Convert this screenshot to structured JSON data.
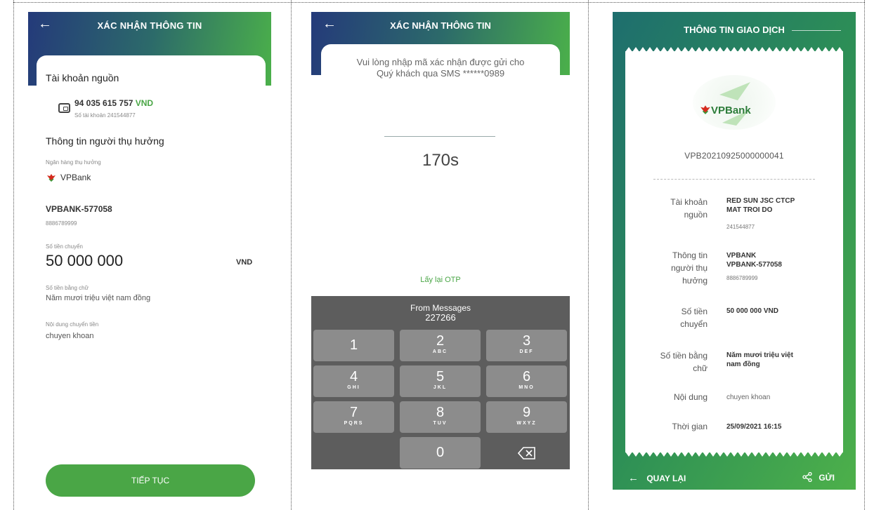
{
  "screen1": {
    "header_title": "XÁC NHẬN THÔNG TIN",
    "source_section": "Tài khoản nguồn",
    "balance_amount": "94 035 615 757",
    "balance_currency": "VND",
    "account_number_line": "Số tài khoản 241544877",
    "beneficiary_section": "Thông tin người thụ hưởng",
    "bank_label": "Ngân hàng thụ hưởng",
    "bank_name": "VPBank",
    "beneficiary_name": "VPBANK-577058",
    "beneficiary_account": "8886789999",
    "amount_label": "Số tiền chuyển",
    "amount_value": "50 000 000",
    "amount_currency": "VND",
    "amount_words_label": "Số tiền bằng chữ",
    "amount_words": "Năm mươi triệu việt nam đồng",
    "content_label": "Nội dung chuyển tiền",
    "content_value": "chuyen khoan",
    "continue_button": "TIẾP TỤC"
  },
  "screen2": {
    "header_title": "XÁC NHẬN THÔNG TIN",
    "message_line1": "Vui lòng nhập mã xác nhận được gửi cho",
    "message_line2": "Quý khách qua SMS ******0989",
    "timer": "170s",
    "resend_otp": "Lấy lại OTP",
    "keyboard": {
      "suggestion_source": "From Messages",
      "suggestion_code": "227266",
      "keys": [
        {
          "n": "1",
          "l": ""
        },
        {
          "n": "2",
          "l": "ABC"
        },
        {
          "n": "3",
          "l": "DEF"
        },
        {
          "n": "4",
          "l": "GHI"
        },
        {
          "n": "5",
          "l": "JKL"
        },
        {
          "n": "6",
          "l": "MNO"
        },
        {
          "n": "7",
          "l": "PQRS"
        },
        {
          "n": "8",
          "l": "TUV"
        },
        {
          "n": "9",
          "l": "WXYZ"
        },
        {
          "n": "0",
          "l": ""
        }
      ]
    }
  },
  "screen3": {
    "title": "THÔNG TIN GIAO DỊCH",
    "logo_text": "VPBank",
    "transaction_id": "VPB20210925000000041",
    "source_label_1": "Tài khoản",
    "source_label_2": "nguồn",
    "source_name_1": "RED SUN JSC CTCP",
    "source_name_2": "MAT TROI DO",
    "source_account": "241544877",
    "beneficiary_label_1": "Thông tin",
    "beneficiary_label_2": "người thụ",
    "beneficiary_label_3": "hưởng",
    "beneficiary_bank": "VPBANK",
    "beneficiary_name": "VPBANK-577058",
    "beneficiary_account": "8886789999",
    "amount_label_1": "Số tiền",
    "amount_label_2": "chuyển",
    "amount_value": "50 000 000 VND",
    "words_label_1": "Số tiền bằng",
    "words_label_2": "chữ",
    "words_value_1": "Năm mươi triệu việt",
    "words_value_2": "nam đồng",
    "content_label": "Nội dung",
    "content_value": "chuyen khoan",
    "time_label": "Thời gian",
    "time_value": "25/09/2021 16:15",
    "back_button": "QUAY LẠI",
    "send_button": "GỬI"
  },
  "colors": {
    "green": "#4aa646",
    "header_blue": "#243a7a",
    "keyboard_bg": "#5d5d5d",
    "key_bg": "#8c8c8c"
  },
  "icons": [
    "back-arrow-icon",
    "wallet-icon",
    "vpbank-logo-icon",
    "backspace-icon",
    "share-icon"
  ]
}
